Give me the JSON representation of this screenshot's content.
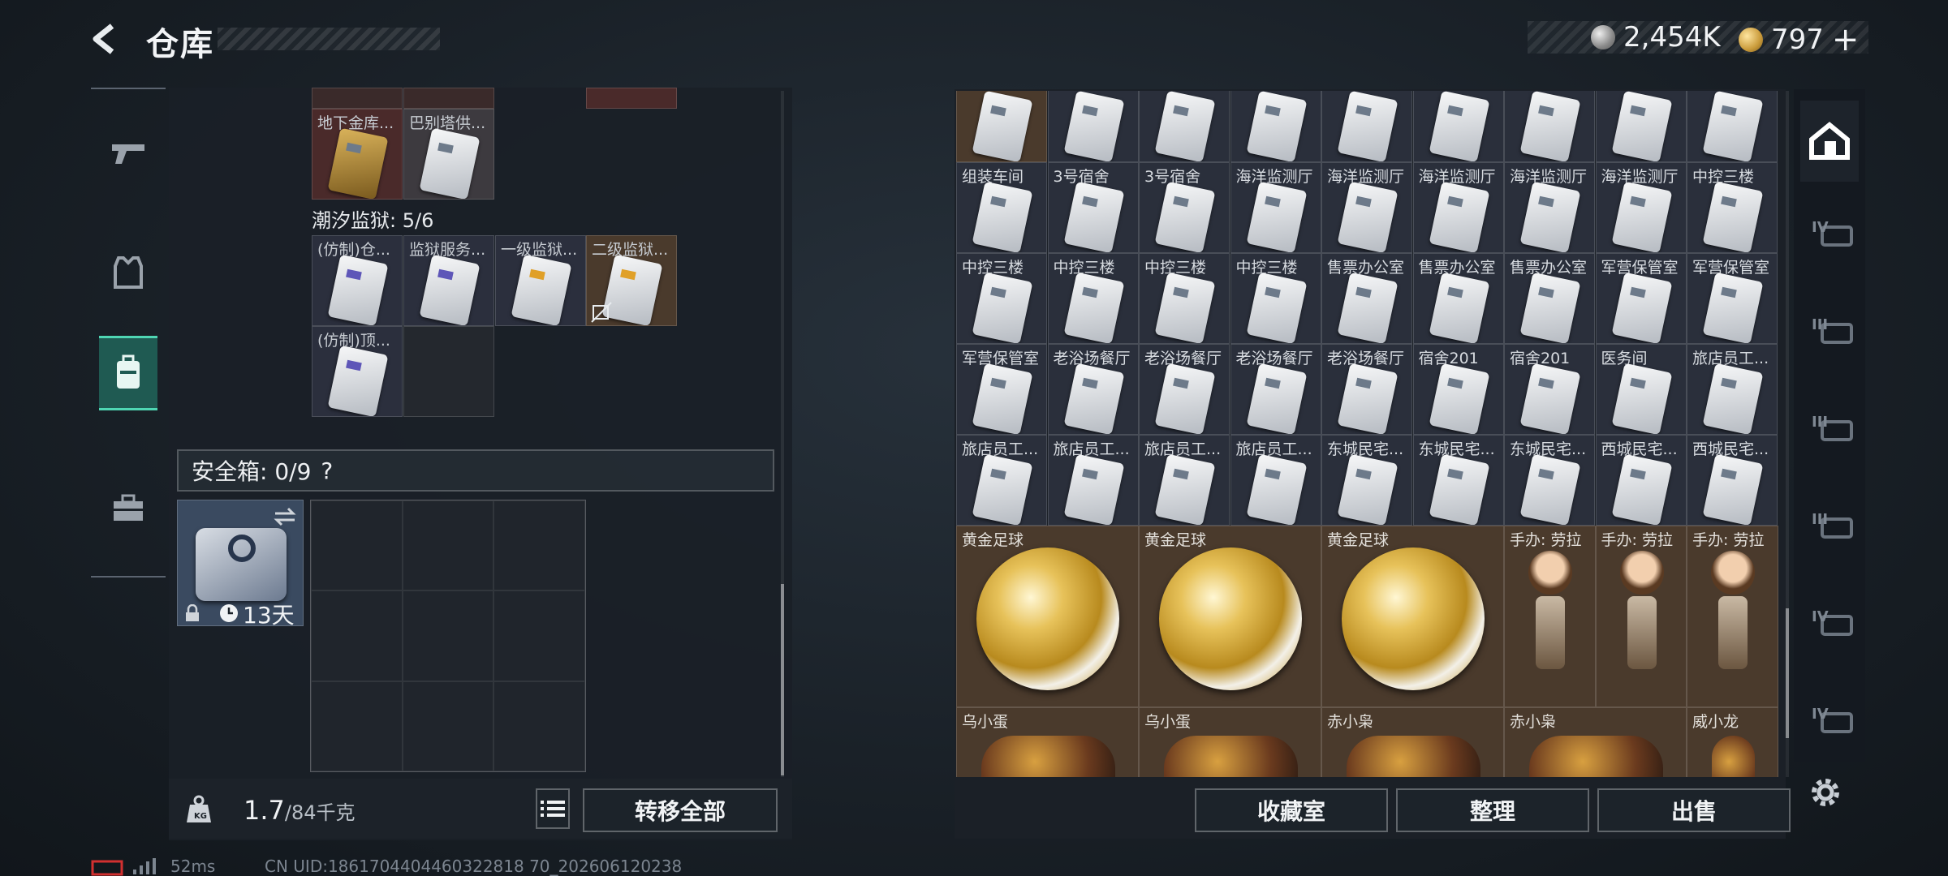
{
  "header": {
    "title": "仓库",
    "back_label": ""
  },
  "currency": {
    "silver": "2,454K",
    "gold": "797",
    "gold_add": "+"
  },
  "sidebar": {
    "items": [
      {
        "name": "weapons"
      },
      {
        "name": "armor"
      },
      {
        "name": "backpack",
        "active": true
      },
      {
        "name": "toolbox"
      }
    ]
  },
  "left_inventory": {
    "top_cells": [
      {
        "label": "地下金库..."
      },
      {
        "label": "巴别塔供..."
      }
    ],
    "prison_label": "潮汐监狱: 5/6",
    "prison_cells": [
      {
        "label": "(仿制)仓..."
      },
      {
        "label": "监狱服务..."
      },
      {
        "label": "一级监狱..."
      },
      {
        "label": "二级监狱..."
      },
      {
        "label": "(仿制)顶..."
      }
    ],
    "safebox_label": "安全箱: 0/9",
    "safebox_help": "?",
    "safebox_timer": "13天",
    "weight_current": "1.7",
    "weight_max": "/84千克",
    "transfer_all": "转移全部"
  },
  "right_inventory": {
    "rows": [
      [
        "",
        "",
        "",
        "",
        "",
        "",
        "",
        "",
        ""
      ],
      [
        "组装车间",
        "3号宿舍",
        "3号宿舍",
        "海洋监测厅",
        "海洋监测厅",
        "海洋监测厅",
        "海洋监测厅",
        "海洋监测厅",
        "中控三楼"
      ],
      [
        "中控三楼",
        "中控三楼",
        "中控三楼",
        "中控三楼",
        "售票办公室",
        "售票办公室",
        "售票办公室",
        "军营保管室",
        "军营保管室"
      ],
      [
        "军营保管室",
        "老浴场餐厅",
        "老浴场餐厅",
        "老浴场餐厅",
        "老浴场餐厅",
        "宿舍201",
        "宿舍201",
        "医务间",
        "旅店员工..."
      ],
      [
        "旅店员工...",
        "旅店员工...",
        "旅店员工...",
        "旅店员工...",
        "东城民宅...",
        "东城民宅...",
        "东城民宅...",
        "西城民宅...",
        "西城民宅..."
      ]
    ],
    "big_items": [
      "黄金足球",
      "黄金足球",
      "黄金足球"
    ],
    "figures": [
      "手办: 劳拉",
      "手办: 劳拉",
      "手办: 劳拉"
    ],
    "bottom_items": [
      "乌小蛋",
      "乌小蛋",
      "赤小枭",
      "赤小枭",
      "威小龙"
    ],
    "buttons": {
      "collection": "收藏室",
      "sort": "整理",
      "sell": "出售"
    }
  },
  "right_tabs": [
    {
      "name": "stash-home",
      "tier": ""
    },
    {
      "name": "tier-4-a",
      "tier": "IV"
    },
    {
      "name": "tier-3-a",
      "tier": "III"
    },
    {
      "name": "tier-3-b",
      "tier": "III"
    },
    {
      "name": "tier-3-c",
      "tier": "III"
    },
    {
      "name": "tier-4-b",
      "tier": "IV"
    },
    {
      "name": "tier-4-c",
      "tier": "IV"
    }
  ],
  "status": {
    "ping": "52ms",
    "uid": "CN UID:1861704404460322818 70_202606120238"
  }
}
